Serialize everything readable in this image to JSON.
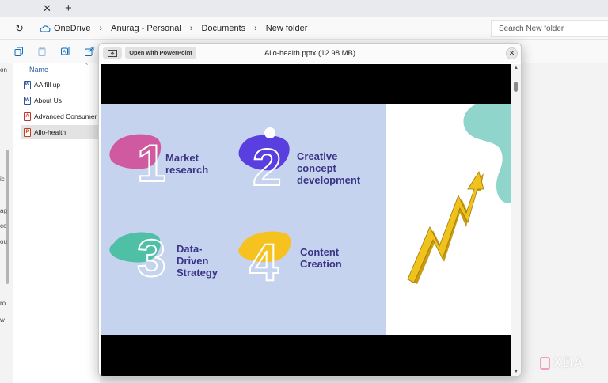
{
  "tabstrip": {
    "close_glyph": "✕",
    "add_glyph": "+"
  },
  "address": {
    "refresh_icon": "refresh-icon",
    "crumbs": [
      "OneDrive",
      "Anurag - Personal",
      "Documents",
      "New folder"
    ],
    "separator": "›",
    "search_placeholder": "Search New folder"
  },
  "toolbar": {
    "icons": [
      "copy-icon",
      "paste-icon",
      "rename-icon",
      "share-icon"
    ]
  },
  "sidebar": {
    "fragments": [
      "on",
      "ic",
      "ag",
      "ce",
      "ou",
      "ro",
      "w"
    ]
  },
  "files": {
    "column_header": "Name",
    "sort_glyph": "^",
    "rows": [
      {
        "name": "AA fill up",
        "type": "word",
        "badge": "W"
      },
      {
        "name": "About Us",
        "type": "word",
        "badge": "W"
      },
      {
        "name": "Advanced Consumer Behaviour",
        "type": "pdf",
        "badge": "A"
      },
      {
        "name": "Allo-health",
        "type": "ppt",
        "badge": "P",
        "selected": true
      }
    ]
  },
  "preview": {
    "open_button": "Open with PowerPoint",
    "filename": "Allo-health.pptx (12.98 MB)",
    "close_glyph": "✕",
    "scroll_up": "▲",
    "scroll_down": "▼",
    "slide": {
      "steps": [
        {
          "number": "1",
          "lines": [
            "Market",
            "research"
          ],
          "blob_color": "#d05aa0"
        },
        {
          "number": "2",
          "lines": [
            "Creative",
            "concept",
            "development"
          ],
          "blob_color": "#5a3fe0"
        },
        {
          "number": "3",
          "lines": [
            "Data-",
            "Driven",
            "Strategy"
          ],
          "blob_color": "#4fbfa6"
        },
        {
          "number": "4",
          "lines": [
            "Content",
            "Creation"
          ],
          "blob_color": "#f5c220"
        }
      ],
      "arrow_color": "#f0c21c",
      "accent_color": "#8fd5cb",
      "panel_color": "#c6d3ee",
      "label_color": "#3b3487"
    }
  },
  "watermark": {
    "text": "XDA"
  }
}
